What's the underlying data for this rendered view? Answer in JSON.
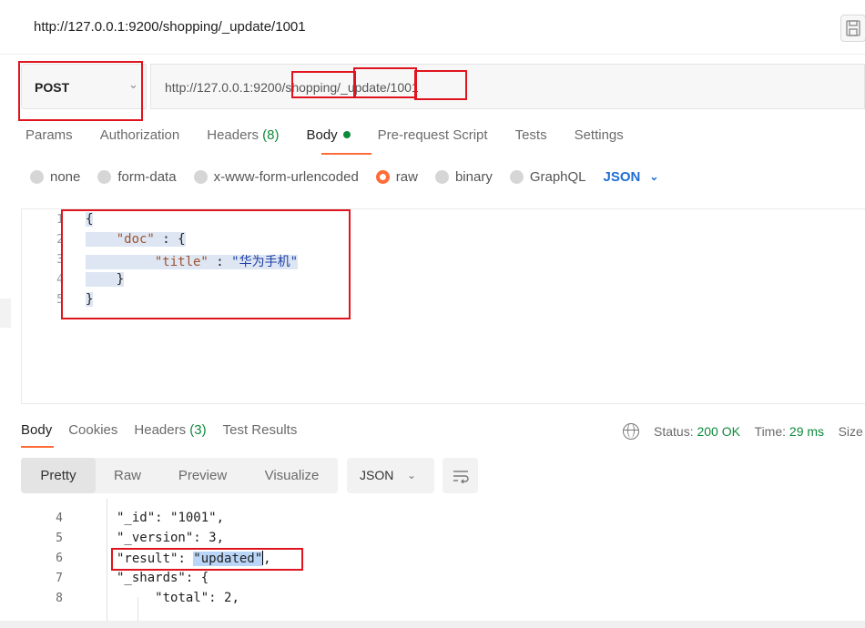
{
  "window": {
    "title": "http://127.0.0.1:9200/shopping/_update/1001",
    "save_icon": "save-icon"
  },
  "request": {
    "method": "POST",
    "url": "http://127.0.0.1:9200/shopping/_update/1001"
  },
  "request_tabs": [
    {
      "label": "Params"
    },
    {
      "label": "Authorization"
    },
    {
      "label": "Headers",
      "count": "(8)"
    },
    {
      "label": "Body"
    },
    {
      "label": "Pre-request Script"
    },
    {
      "label": "Tests"
    },
    {
      "label": "Settings"
    }
  ],
  "body_types": [
    "none",
    "form-data",
    "x-www-form-urlencoded",
    "raw",
    "binary",
    "GraphQL"
  ],
  "body_type_selected": "raw",
  "body_format": "JSON",
  "editor": {
    "line_numbers": [
      "1",
      "2",
      "3",
      "4",
      "5"
    ],
    "lines": [
      "{",
      "\"doc\" : {",
      "\"title\" : \"华为手机\"",
      "}",
      "}"
    ],
    "key_doc": "\"doc\"",
    "key_title": "\"title\"",
    "value_title": "\"华为手机\""
  },
  "response_tabs": [
    {
      "label": "Body"
    },
    {
      "label": "Cookies"
    },
    {
      "label": "Headers",
      "count": "(3)"
    },
    {
      "label": "Test Results"
    }
  ],
  "status": {
    "status_label": "Status:",
    "status_value": "200 OK",
    "time_label": "Time:",
    "time_value": "29 ms",
    "size_label": "Size"
  },
  "view_modes": [
    "Pretty",
    "Raw",
    "Preview",
    "Visualize"
  ],
  "view_mode_selected": "Pretty",
  "response_format": "JSON",
  "response": {
    "line_numbers": [
      "4",
      "5",
      "6",
      "7",
      "8"
    ],
    "id_key": "\"_id\"",
    "id_value": "\"1001\"",
    "version_key": "\"_version\"",
    "version_value": "3",
    "result_key": "\"result\"",
    "result_value": "\"updated\"",
    "shards_key": "\"_shards\"",
    "total_key": "\"total\"",
    "total_value": "2"
  },
  "colors": {
    "accent": "#ff6c37",
    "success": "#0f8a3c",
    "link": "#1f6ed4",
    "annotation": "#e0141e"
  }
}
